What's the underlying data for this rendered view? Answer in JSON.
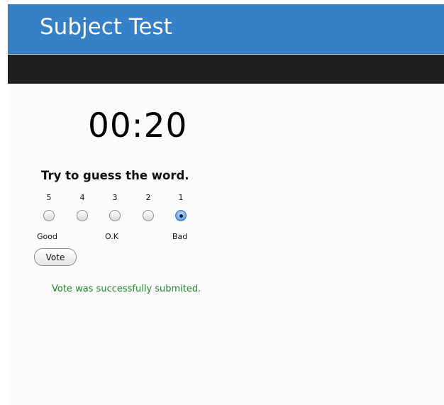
{
  "header": {
    "title": "Subject Test"
  },
  "timer": {
    "display": "00:20"
  },
  "question": {
    "text": "Try to guess the word."
  },
  "rating": {
    "scale_numbers": [
      "5",
      "4",
      "3",
      "2",
      "1"
    ],
    "selected_value": "1",
    "labels": {
      "good": "Good",
      "ok": "O.K",
      "bad": "Bad"
    }
  },
  "vote": {
    "button_label": "Vote",
    "success_message": "Vote was successfully submited."
  },
  "colors": {
    "header_blue": "#3580c6",
    "navbar_dark": "#1f1f1f",
    "success_green": "#1f8a2a"
  }
}
